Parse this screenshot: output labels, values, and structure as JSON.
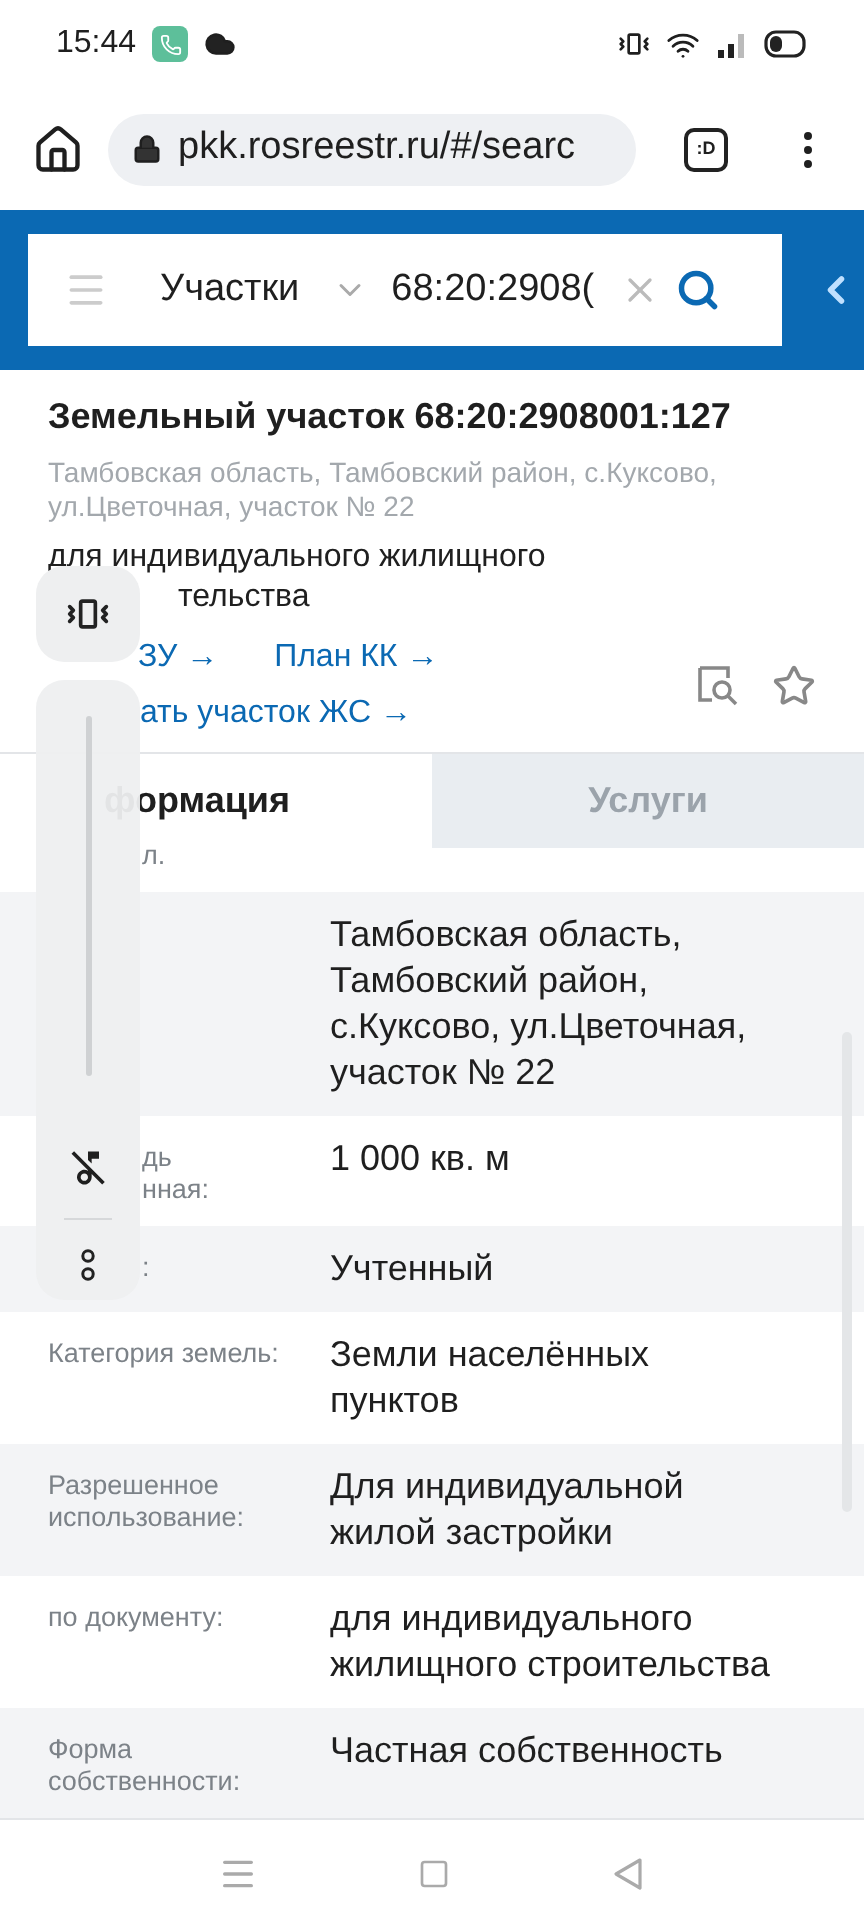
{
  "status_bar": {
    "time": "15:44"
  },
  "browser": {
    "url": "pkk.rosreestr.ru/#/searc",
    "tab_button": ":D"
  },
  "search": {
    "category": "Участки",
    "query": "68:20:2908("
  },
  "object": {
    "title": "Земельный участок 68:20:2908001:127",
    "address": "Тамбовская область, Тамбовский район, с.Куксово, ул.Цветочная, участок № 22",
    "purpose": "для индивидуального жилищного",
    "purpose_fragment": "тельства",
    "links": [
      {
        "label": "ЗУ →"
      },
      {
        "label": "План КК →"
      }
    ],
    "link_fragment": "ать участок ЖС →"
  },
  "volume": {
    "level": 0
  },
  "tabs": [
    {
      "label": "формация",
      "selected": true
    },
    {
      "label": "Услуги",
      "selected": false
    }
  ],
  "rows": [
    {
      "label": "л.",
      "shade": false,
      "kind": "stub"
    },
    {
      "value": "Тамбовская область, Тамбовский район, с.Куксово, ул.Цветочная, участок № 22",
      "shade": true,
      "kind": "covered"
    },
    {
      "label": "дь\nнная:",
      "value": "1 000 кв. м",
      "shade": false,
      "kind": "covered"
    },
    {
      "label": ":",
      "value": "Учтенный",
      "shade": true,
      "kind": "covered"
    },
    {
      "label": "Категория земель:",
      "value": "Земли населённых пунктов",
      "shade": false,
      "kind": "full"
    },
    {
      "label": "Разрешенное использование:",
      "value": "Для индивидуальной жилой застройки",
      "shade": true,
      "kind": "full"
    },
    {
      "label": "по документу:",
      "value": "для индивидуального жилищного строительства",
      "shade": false,
      "kind": "full"
    },
    {
      "label": "Форма собственности:",
      "value": "Частная собственность",
      "shade": true,
      "kind": "full"
    }
  ]
}
